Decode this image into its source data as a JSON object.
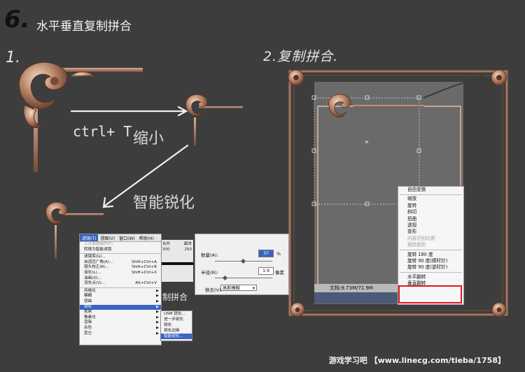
{
  "title": {
    "number": "6.",
    "text": "水平垂直复制拼合"
  },
  "annotations": {
    "step1": "1.",
    "step2": "2.复制拼合.",
    "ctrl_t": "ctrl+ T",
    "shrink": "缩小",
    "smart_sharpen": "智能锐化",
    "sub_merge": "制拼合"
  },
  "filter_menu": {
    "menubar": [
      "滤镜(T)",
      "视图(V)",
      "窗口(W)",
      "帮助(H)"
    ],
    "items": [
      {
        "label": "上次滤镜操作(F)",
        "shortcut": "",
        "disabled": true
      },
      {
        "label": "转换为智能滤镜",
        "shortcut": ""
      },
      {
        "sep": true
      },
      {
        "label": "滤镜库(G)...",
        "shortcut": ""
      },
      {
        "label": "自适应广角(A)...",
        "shortcut": "Shift+Ctrl+A"
      },
      {
        "label": "镜头校正(R)...",
        "shortcut": "Shift+Ctrl+R"
      },
      {
        "label": "液化(L)...",
        "shortcut": "Shift+Ctrl+X"
      },
      {
        "label": "油画(O)...",
        "shortcut": ""
      },
      {
        "label": "消失点(V)...",
        "shortcut": "Alt+Ctrl+V"
      },
      {
        "sep": true
      },
      {
        "label": "风格化",
        "arrow": true
      },
      {
        "label": "模糊",
        "arrow": true
      },
      {
        "label": "扭曲",
        "arrow": true
      },
      {
        "label": "锐化",
        "arrow": true,
        "selected": true
      },
      {
        "label": "视频",
        "arrow": true
      },
      {
        "label": "像素化",
        "arrow": true
      },
      {
        "label": "渲染",
        "arrow": true
      },
      {
        "label": "杂色",
        "arrow": true
      },
      {
        "label": "其它",
        "arrow": true
      }
    ]
  },
  "bg_panel": {
    "tab": "合并",
    "col": "副本",
    "v1": "300",
    "v2": "250"
  },
  "sharpen_submenu": [
    "USM 锐化...",
    "进一步锐化",
    "锐化",
    "锐化边缘",
    "智能锐化..."
  ],
  "sharpen_dialog": {
    "amount_label": "数量(A):",
    "amount_value": "37",
    "amount_unit": "%",
    "radius_label": "半径(R):",
    "radius_value": "1.9",
    "radius_unit": "像素",
    "remove_label": "移去(V):",
    "remove_value": "高斯模糊"
  },
  "status_bar": "文档:9.73M/71.9M",
  "context_menu": {
    "items": [
      {
        "label": "自由变换"
      },
      {
        "sep": true
      },
      {
        "label": "缩放"
      },
      {
        "label": "旋转"
      },
      {
        "label": "斜切"
      },
      {
        "label": "扭曲"
      },
      {
        "label": "透视"
      },
      {
        "label": "变形"
      },
      {
        "label": "内容识别比例",
        "disabled": true
      },
      {
        "label": "操控变形",
        "disabled": true
      },
      {
        "sep": true
      },
      {
        "label": "旋转 180 度"
      },
      {
        "label": "旋转 90 度(顺时针)"
      },
      {
        "label": "旋转 90 度(逆时针)"
      },
      {
        "sep": true
      },
      {
        "label": "水平翻转"
      },
      {
        "label": "垂直翻转"
      }
    ]
  },
  "footer": "游戏学习吧 【www.linecg.com/tieba/1758】",
  "colors": {
    "background": "#3d3d3d",
    "ornament": "#c9a08a",
    "highlight_box": "#e0161b",
    "menu_selected": "#3a64c0"
  }
}
